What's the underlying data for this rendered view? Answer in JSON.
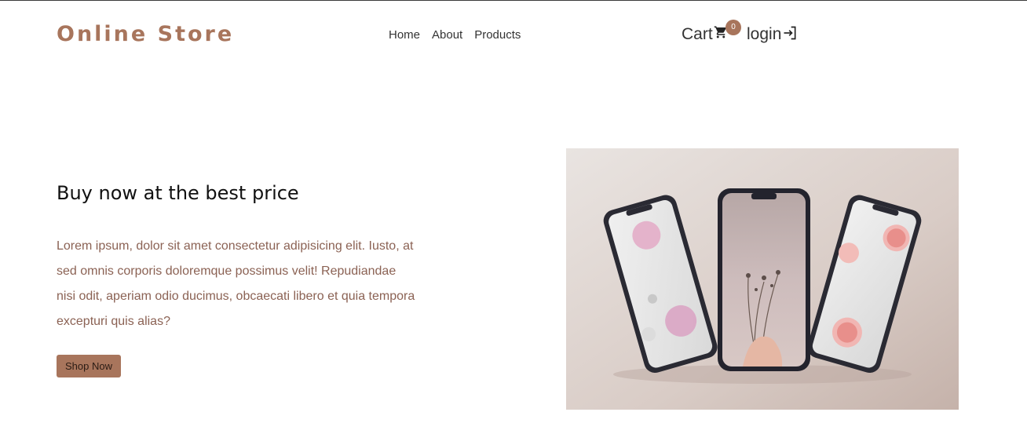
{
  "header": {
    "logo": "Online Store",
    "nav": [
      "Home",
      "About",
      "Products"
    ],
    "cart_label": "Cart",
    "cart_count": "0",
    "cart_icon": "cart-icon",
    "login_label": "login",
    "login_icon": "login-icon"
  },
  "hero": {
    "title": "Buy now at the best price",
    "description": "Lorem ipsum, dolor sit amet consectetur adipisicing elit. Iusto, at sed omnis corporis doloremque possimus velit! Repudiandae nisi odit, aperiam odio ducimus, obcaecati libero et quia tempora excepturi quis alias?",
    "button": "Shop Now",
    "image": "three-phones-product-photo"
  },
  "colors": {
    "brand": "#a8755c",
    "text": "#333333",
    "description": "#8b6254"
  }
}
